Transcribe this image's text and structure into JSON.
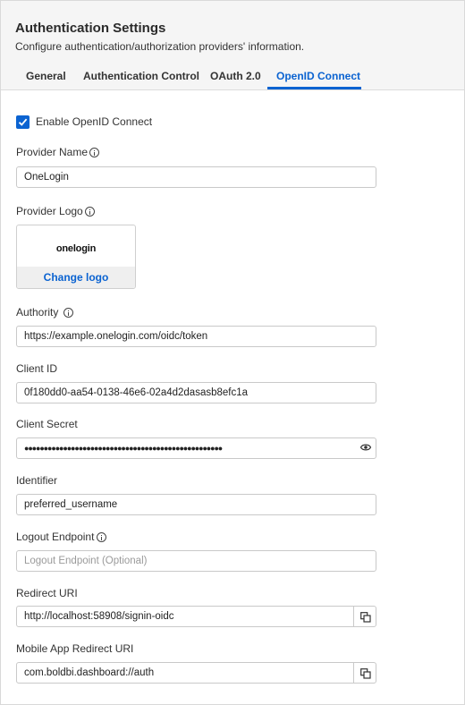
{
  "header": {
    "title": "Authentication Settings",
    "subtitle": "Configure authentication/authorization providers' information."
  },
  "tabs": [
    {
      "label": "General",
      "active": false
    },
    {
      "label": "Authentication Control",
      "active": false
    },
    {
      "label": "OAuth 2.0",
      "active": false
    },
    {
      "label": "OpenID Connect",
      "active": true
    }
  ],
  "enable": {
    "label": "Enable OpenID Connect",
    "checked": true
  },
  "provider_name": {
    "label": "Provider Name",
    "value": "OneLogin"
  },
  "provider_logo": {
    "label": "Provider Logo",
    "logo_text": "onelogin",
    "change_label": "Change logo"
  },
  "authority": {
    "label": "Authority",
    "value": "https://example.onelogin.com/oidc/token"
  },
  "client_id": {
    "label": "Client ID",
    "value": "0f180dd0-aa54-0138-46e6-02a4d2dasasb8efc1a"
  },
  "client_secret": {
    "label": "Client Secret",
    "value": "●●●●●●●●●●●●●●●●●●●●●●●●●●●●●●●●●●●●●●●●●●●●●●●●●●●"
  },
  "identifier": {
    "label": "Identifier",
    "value": "preferred_username"
  },
  "logout_endpoint": {
    "label": "Logout Endpoint",
    "value": "",
    "placeholder": "Logout Endpoint (Optional)"
  },
  "redirect_uri": {
    "label": "Redirect URI",
    "value": "http://localhost:58908/signin-oidc"
  },
  "mobile_redirect_uri": {
    "label": "Mobile App Redirect URI",
    "value": "com.boldbi.dashboard://auth"
  },
  "colors": {
    "accent": "#0b63d1",
    "header_bg": "#f5f5f5"
  },
  "icons": [
    "check-icon",
    "info-icon",
    "eye-icon",
    "copy-icon"
  ]
}
